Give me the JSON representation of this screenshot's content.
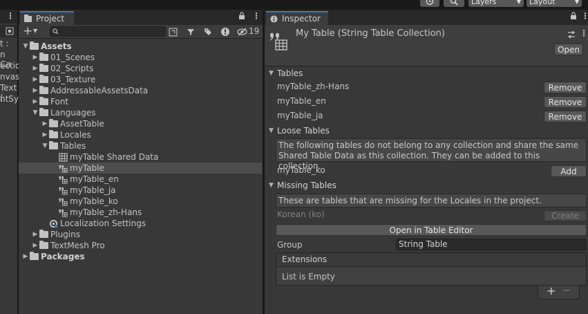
{
  "toolbar": {
    "history_icon": "history-icon",
    "search_icon": "search-icon",
    "layers_label": "Layers",
    "layout_label": "Layout"
  },
  "hierarchy": {
    "fragments": [
      "t :",
      "n Ca",
      "ectio",
      "nvas",
      "Text (",
      "ntSy"
    ]
  },
  "project": {
    "tab_label": "Project",
    "hidden_count": "19",
    "tree": [
      {
        "label": "Assets",
        "depth": 0,
        "expanded": true,
        "bold": true,
        "icon": "folder"
      },
      {
        "label": "01_Scenes",
        "depth": 1,
        "expanded": false,
        "icon": "folder"
      },
      {
        "label": "02_Scripts",
        "depth": 1,
        "expanded": false,
        "icon": "folder"
      },
      {
        "label": "03_Texture",
        "depth": 1,
        "expanded": false,
        "icon": "folder"
      },
      {
        "label": "AddressableAssetsData",
        "depth": 1,
        "expanded": false,
        "icon": "folder"
      },
      {
        "label": "Font",
        "depth": 1,
        "expanded": false,
        "icon": "folder"
      },
      {
        "label": "Languages",
        "depth": 1,
        "expanded": true,
        "icon": "folder"
      },
      {
        "label": "AssetTable",
        "depth": 2,
        "expanded": false,
        "icon": "folder"
      },
      {
        "label": "Locales",
        "depth": 2,
        "expanded": false,
        "icon": "folder"
      },
      {
        "label": "Tables",
        "depth": 2,
        "expanded": true,
        "icon": "folder"
      },
      {
        "label": "myTable Shared Data",
        "depth": 3,
        "icon": "grid"
      },
      {
        "label": "myTable",
        "depth": 3,
        "icon": "table",
        "selected": true
      },
      {
        "label": "myTable_en",
        "depth": 3,
        "icon": "table"
      },
      {
        "label": "myTable_ja",
        "depth": 3,
        "icon": "table"
      },
      {
        "label": "myTable_ko",
        "depth": 3,
        "icon": "table"
      },
      {
        "label": "myTable_zh-Hans",
        "depth": 3,
        "icon": "table"
      },
      {
        "label": "Localization Settings",
        "depth": 2,
        "icon": "settings"
      },
      {
        "label": "Plugins",
        "depth": 1,
        "expanded": false,
        "icon": "folder"
      },
      {
        "label": "TextMesh Pro",
        "depth": 1,
        "expanded": false,
        "icon": "folder"
      },
      {
        "label": "Packages",
        "depth": 0,
        "expanded": false,
        "bold": true,
        "icon": "folder"
      }
    ]
  },
  "inspector": {
    "tab_label": "Inspector",
    "title": "My Table (String Table Collection)",
    "open_label": "Open",
    "tables_header": "Tables",
    "tables": [
      {
        "name": "myTable_zh-Hans",
        "action": "Remove"
      },
      {
        "name": "myTable_en",
        "action": "Remove"
      },
      {
        "name": "myTable_ja",
        "action": "Remove"
      }
    ],
    "loose_header": "Loose Tables",
    "loose_help": "The following tables do not belong to any collection and share the same Shared Table Data as this collection. They can be added to this collection.",
    "loose_table": "myTable_ko",
    "add_label": "Add",
    "missing_header": "Missing Tables",
    "missing_help": "These are tables that are missing for the Locales in the project.",
    "missing_locale": "Korean (ko)",
    "create_label": "Create",
    "open_editor_label": "Open in Table Editor",
    "group_label": "Group",
    "group_value": "String Table",
    "extensions_label": "Extensions",
    "extensions_empty": "List is Empty",
    "plus": "+",
    "minus": "−"
  }
}
